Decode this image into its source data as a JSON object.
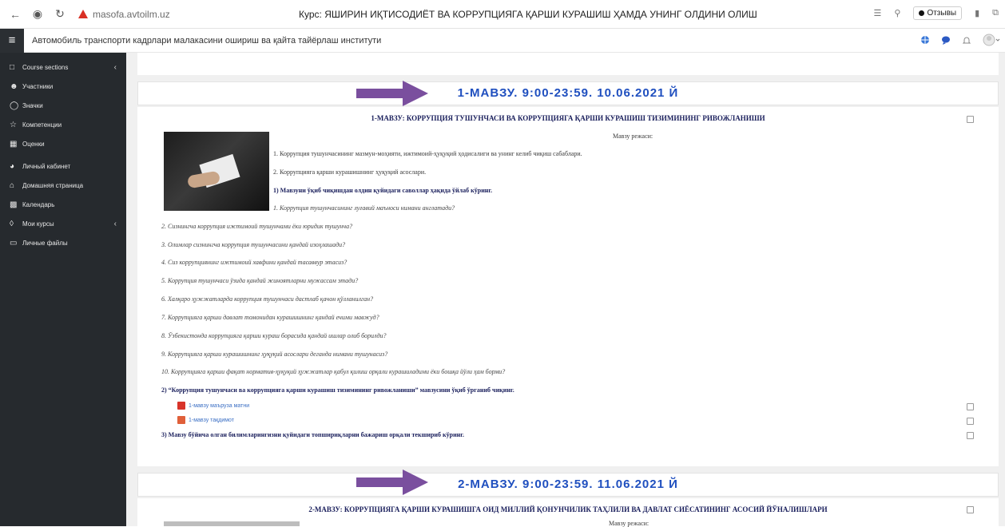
{
  "browser": {
    "url": "masofa.avtoilm.uz",
    "page_title": "Курс: ЯШИРИН ИҚТИСОДИЁТ ВА КОРРУПЦИЯГА ҚАРШИ КУРАШИШ ҲАМДА УНИНГ ОЛДИНИ ОЛИШ",
    "feedback_label": "Отзывы"
  },
  "app": {
    "site_name": "Автомобиль транспорти кадрлари малакасини ошириш ва қайта тайёрлаш институти"
  },
  "sidebar": {
    "items": [
      {
        "label": "Course sections",
        "icon": "folder-icon",
        "has_chevron": true
      },
      {
        "label": "Участники",
        "icon": "users-icon"
      },
      {
        "label": "Значки",
        "icon": "badge-icon"
      },
      {
        "label": "Компетенции",
        "icon": "star-icon"
      },
      {
        "label": "Оценки",
        "icon": "grades-icon"
      },
      {
        "label": "Личный кабинет",
        "icon": "dashboard-icon"
      },
      {
        "label": "Домашняя страница",
        "icon": "home-icon"
      },
      {
        "label": "Календарь",
        "icon": "calendar-icon"
      },
      {
        "label": "Мои курсы",
        "icon": "courses-icon",
        "has_chevron": true
      },
      {
        "label": "Личные файлы",
        "icon": "files-icon"
      }
    ]
  },
  "topic1": {
    "header": "1-МАВЗУ. 9:00-23:59. 10.06.2021 Й",
    "title": "1-МАВЗУ: КОРРУПЦИЯ ТУШУНЧАСИ ВА КОРРУПЦИЯГА ҚАРШИ КУРАШИШ ТИЗИМИНИНГ РИВОЖЛАНИШИ",
    "plan_label": "Мавзу режаси:",
    "plan_items": [
      "1. Коррупция тушунчасининг мазмун-моҳияти, ижтимоий-ҳуқуқий ҳодисалиги ва унинг келиб чиқиш сабаблари.",
      "2. Коррупцияга қарши курашишнинг ҳуқуқий асослари."
    ],
    "questions_heading": "1) Мавзуни ўқиб чиқишдан олдин қуйидаги саволлар ҳақида ўйлаб кўринг.",
    "questions": [
      "1. Коррупция тушунчасининг луғавий маъноси нимани англатади?",
      "2. Сизнингча коррупция ижтимоий тушунчами ёки юридик тушунча?",
      "3. Олимлар сизнингча коррупция тушунчасини қандай изоҳлашади?",
      "4. Сиз коррупциянинг ижтимоий хавфини қандай тасаввур этасиз?",
      "5. Коррупция тушунчаси ўзида қандай жиноятларни мужассам этади?",
      "6. Халқаро ҳужжатларда коррупция тушунчаси дастлаб қачон қўлланилган?",
      "7. Коррупцияга қарши давлат томонидан курашишнинг қандай ечими мавжуд?",
      "8. Ўзбекистонда коррупцияга қарши кураш борасида қандай ишлар олиб борилди?",
      "9. Коррупцияга қарши курашишнинг ҳуқуқий асослари деганда нимани тушунасиз?",
      "10. Коррупцияга қарши фақат норматив-ҳуқуқий ҳужжатлар қабул қилиш орқали курашиладими ёки бошқа йўли ҳам борми?"
    ],
    "study_heading": "2) “Коррупция тушунчаси ва коррупцияга қарши курашиш тизимининг ривожланиши” мавзусини ўқиб ўрганиб чиқинг.",
    "resources": [
      {
        "label": "1-мавзу маъруза матни",
        "icon": "pdf-icon"
      },
      {
        "label": "1-мавзу тақдимот",
        "icon": "presentation-icon"
      }
    ],
    "check_heading": "3) Мавзу бўйича олган билимларингизни қуйидаги топшириқларни бажариш орқали текшириб кўринг."
  },
  "topic2": {
    "header": "2-МАВЗУ. 9:00-23:59. 11.06.2021 Й",
    "title": "2-МАВЗУ: КОРРУПЦИЯГА ҚАРШИ КУРАШИШГА ОИД МИЛЛИЙ ҚОНУНЧИЛИК ТАҲЛИЛИ ВА ДАВЛАТ СИЁСАТИНИНГ АСОСИЙ ЙЎНАЛИШЛАРИ",
    "plan_label": "Мавзу режаси:"
  },
  "colors": {
    "sidebar_bg": "#262a2e",
    "topic_header": "#1f4fbf",
    "arrow": "#7a4f9e",
    "title_text": "#1a1f5c",
    "link": "#3b6fc4"
  }
}
